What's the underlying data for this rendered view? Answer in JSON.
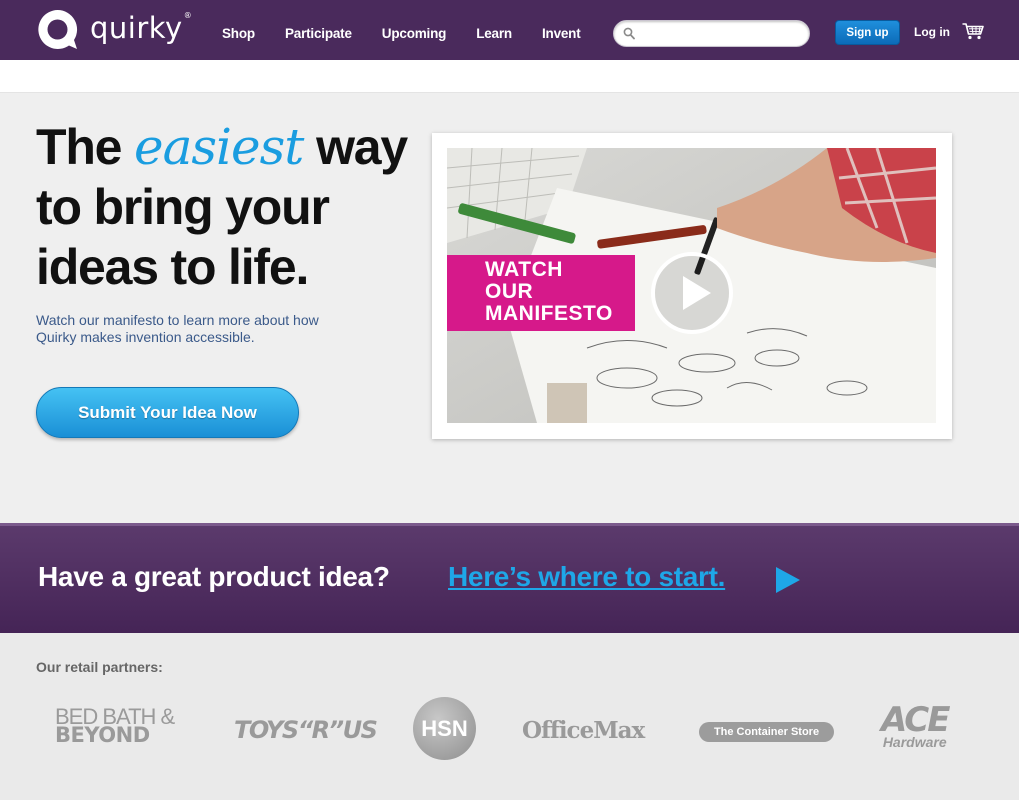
{
  "header": {
    "logo_text": "quirky",
    "logo_mark": "®",
    "nav": [
      "Shop",
      "Participate",
      "Upcoming",
      "Learn",
      "Invent"
    ],
    "search_placeholder": "",
    "signup_label": "Sign up",
    "login_label": "Log in",
    "cart_icon": "cart-icon"
  },
  "hero": {
    "headline_pre": "The",
    "headline_em": "easiest",
    "headline_post": "way to bring your ideas to life.",
    "subtext": "Watch our manifesto to learn more about how Quirky makes invention accessible.",
    "cta_label": "Submit Your Idea Now",
    "video_label_lines": [
      "WATCH",
      "OUR",
      "MANIFESTO"
    ],
    "play_icon": "play-icon"
  },
  "banner": {
    "question": "Have a great product idea?",
    "link": "Here’s where to start.",
    "arrow_icon": "play-arrow-icon"
  },
  "partners": {
    "title": "Our retail partners:",
    "logos": [
      "BED BATH &",
      "BEYOND",
      "TOYS“R”US",
      "HSN",
      "OfficeMax",
      "The Container Store",
      "ACE",
      "Hardware"
    ]
  },
  "colors": {
    "brand_purple": "#4a2a5c",
    "accent_blue": "#1a9de0",
    "label_pink": "#d6198a"
  }
}
